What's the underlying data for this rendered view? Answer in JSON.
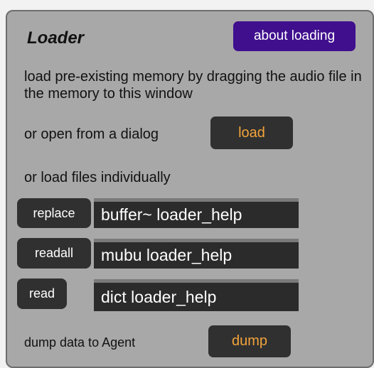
{
  "loader": {
    "title": "Loader",
    "about_label": "about loading",
    "description": "load pre-existing memory by dragging the audio file in the memory to this window",
    "open_dialog_text": "or open from a dialog",
    "load_label": "load",
    "individual_text": "or load files individually",
    "rows": [
      {
        "button": "replace",
        "target": "buffer~ loader_help"
      },
      {
        "button": "readall",
        "target": "mubu loader_help"
      },
      {
        "button": "read",
        "target": "dict loader_help"
      }
    ],
    "dump_text": "dump data to Agent",
    "dump_label": "dump",
    "colors": {
      "panel": "#a8a8a8",
      "about_button": "#3f0f8e",
      "dark_button": "#303030",
      "accent_text": "#f3a43a"
    }
  }
}
